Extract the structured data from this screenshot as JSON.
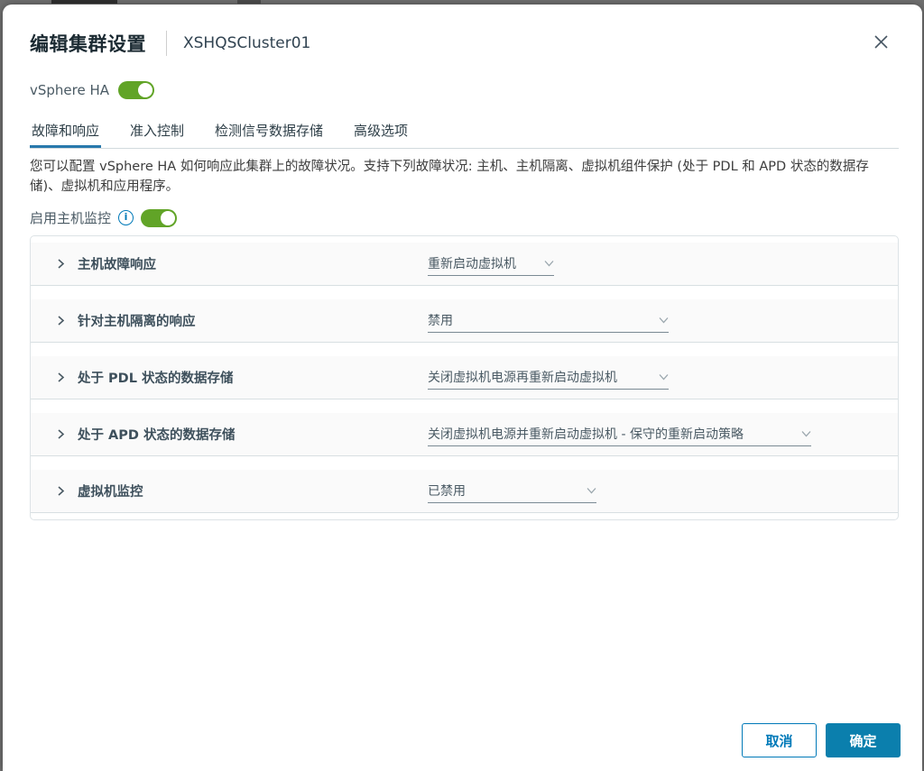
{
  "dialog": {
    "title": "编辑集群设置",
    "cluster_name": "XSHQSCluster01",
    "ha_toggle": {
      "label": "vSphere HA",
      "state": "on"
    },
    "tabs": [
      {
        "label": "故障和响应",
        "active": true
      },
      {
        "label": "准入控制",
        "active": false
      },
      {
        "label": "检测信号数据存储",
        "active": false
      },
      {
        "label": "高级选项",
        "active": false
      }
    ],
    "description": "您可以配置 vSphere HA 如何响应此集群上的故障状况。支持下列故障状况: 主机、主机隔离、虚拟机组件保护 (处于 PDL 和 APD 状态的数据存储)、虚拟机和应用程序。",
    "host_monitoring": {
      "label": "启用主机监控",
      "info_icon": "info-circle-icon",
      "state": "on"
    },
    "rows": [
      {
        "label": "主机故障响应",
        "value": "重新启动虚拟机"
      },
      {
        "label": "针对主机隔离的响应",
        "value": "禁用"
      },
      {
        "label": "处于 PDL 状态的数据存储",
        "value": "关闭虚拟机电源再重新启动虚拟机"
      },
      {
        "label": "处于 APD 状态的数据存储",
        "value": "关闭虚拟机电源并重新启动虚拟机 - 保守的重新启动策略"
      },
      {
        "label": "虚拟机监控",
        "value": "已禁用"
      }
    ],
    "footer": {
      "cancel_label": "取消",
      "ok_label": "确定"
    },
    "colors": {
      "accent_blue": "#0079B8",
      "toggle_green": "#61A427",
      "ok_button": "#0B7FAD"
    }
  }
}
